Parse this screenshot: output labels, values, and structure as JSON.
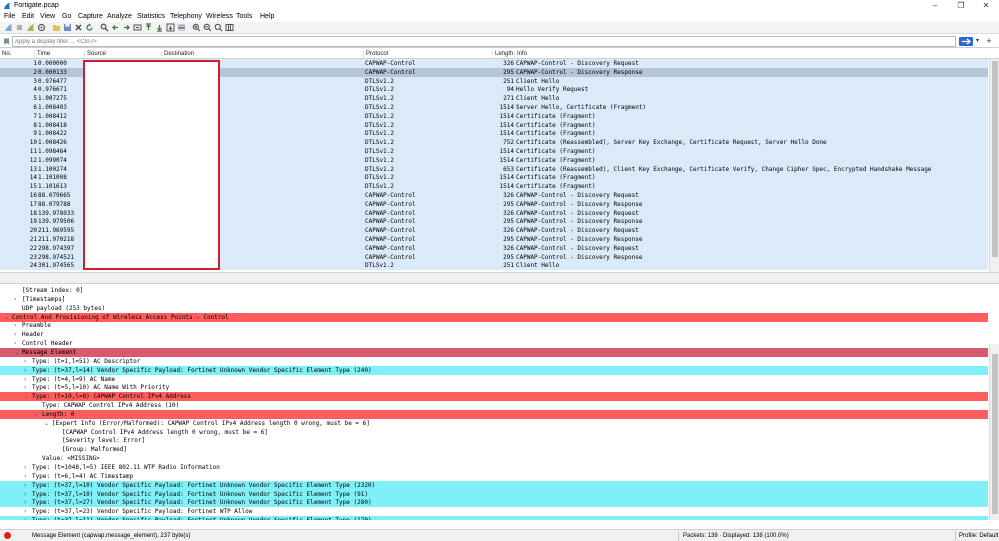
{
  "window": {
    "title": "Fortigate.pcap"
  },
  "menu": [
    "File",
    "Edit",
    "View",
    "Go",
    "Capture",
    "Analyze",
    "Statistics",
    "Telephony",
    "Wireless",
    "Tools",
    "Help"
  ],
  "filter": {
    "placeholder": "Apply a display filter ... <Ctrl-/>"
  },
  "columns": {
    "no": "No.",
    "time": "Time",
    "source": "Source",
    "destination": "Destination",
    "protocol": "Protocol",
    "length": "Length",
    "info": "Info"
  },
  "packets": [
    {
      "no": "1",
      "time": "0.000000",
      "protocol": "CAPWAP-Control",
      "length": "326",
      "info": "CAPWAP-Control - Discovery Request"
    },
    {
      "no": "2",
      "time": "0.000133",
      "protocol": "CAPWAP-Control",
      "length": "295",
      "info": "CAPWAP-Control - Discovery Response"
    },
    {
      "no": "3",
      "time": "0.976477",
      "protocol": "DTLSv1.2",
      "length": "251",
      "info": "Client Hello"
    },
    {
      "no": "4",
      "time": "0.976671",
      "protocol": "DTLSv1.2",
      "length": "94",
      "info": "Hello Verify Request"
    },
    {
      "no": "5",
      "time": "1.007275",
      "protocol": "DTLSv1.2",
      "length": "271",
      "info": "Client Hello"
    },
    {
      "no": "6",
      "time": "1.008403",
      "protocol": "DTLSv1.2",
      "length": "1514",
      "info": "Server Hello, Certificate (Fragment)"
    },
    {
      "no": "7",
      "time": "1.008412",
      "protocol": "DTLSv1.2",
      "length": "1514",
      "info": "Certificate (Fragment)"
    },
    {
      "no": "8",
      "time": "1.008418",
      "protocol": "DTLSv1.2",
      "length": "1514",
      "info": "Certificate (Fragment)"
    },
    {
      "no": "9",
      "time": "1.008422",
      "protocol": "DTLSv1.2",
      "length": "1514",
      "info": "Certificate (Fragment)"
    },
    {
      "no": "10",
      "time": "1.008426",
      "protocol": "DTLSv1.2",
      "length": "752",
      "info": "Certificate (Reassembled), Server Key Exchange, Certificate Request, Server Hello Done"
    },
    {
      "no": "11",
      "time": "1.098464",
      "protocol": "DTLSv1.2",
      "length": "1514",
      "info": "Certificate (Fragment)"
    },
    {
      "no": "12",
      "time": "1.099074",
      "protocol": "DTLSv1.2",
      "length": "1514",
      "info": "Certificate (Fragment)"
    },
    {
      "no": "13",
      "time": "1.100274",
      "protocol": "DTLSv1.2",
      "length": "653",
      "info": "Certificate (Reassembled), Client Key Exchange, Certificate Verify, Change Cipher Spec, Encrypted Handshake Message"
    },
    {
      "no": "14",
      "time": "1.101008",
      "protocol": "DTLSv1.2",
      "length": "1514",
      "info": "Certificate (Fragment)"
    },
    {
      "no": "15",
      "time": "1.101613",
      "protocol": "DTLSv1.2",
      "length": "1514",
      "info": "Certificate (Fragment)"
    },
    {
      "no": "16",
      "time": "88.079665",
      "protocol": "CAPWAP-Control",
      "length": "326",
      "info": "CAPWAP-Control - Discovery Request"
    },
    {
      "no": "17",
      "time": "88.079788",
      "protocol": "CAPWAP-Control",
      "length": "295",
      "info": "CAPWAP-Control - Discovery Response"
    },
    {
      "no": "18",
      "time": "139.978033",
      "protocol": "CAPWAP-Control",
      "length": "326",
      "info": "CAPWAP-Control - Discovery Request"
    },
    {
      "no": "19",
      "time": "139.979506",
      "protocol": "CAPWAP-Control",
      "length": "295",
      "info": "CAPWAP-Control - Discovery Response"
    },
    {
      "no": "20",
      "time": "211.969595",
      "protocol": "CAPWAP-Control",
      "length": "326",
      "info": "CAPWAP-Control - Discovery Request"
    },
    {
      "no": "21",
      "time": "211.970218",
      "protocol": "CAPWAP-Control",
      "length": "295",
      "info": "CAPWAP-Control - Discovery Response"
    },
    {
      "no": "22",
      "time": "298.974397",
      "protocol": "CAPWAP-Control",
      "length": "326",
      "info": "CAPWAP-Control - Discovery Request"
    },
    {
      "no": "23",
      "time": "298.974521",
      "protocol": "CAPWAP-Control",
      "length": "295",
      "info": "CAPWAP-Control - Discovery Response"
    },
    {
      "no": "24",
      "time": "301.974565",
      "protocol": "DTLSv1.2",
      "length": "251",
      "info": "Client Hello"
    }
  ],
  "details": [
    {
      "indent": 0,
      "arrow": "",
      "text": "[Stream index: 0]",
      "hl": ""
    },
    {
      "indent": 0,
      "arrow": ">",
      "text": "[Timestamps]",
      "hl": ""
    },
    {
      "indent": 0,
      "arrow": "",
      "text": "UDP payload (253 bytes)",
      "hl": ""
    },
    {
      "indent": -1,
      "arrow": "v",
      "text": "Control And Provisioning of Wireless Access Points - Control",
      "hl": "red"
    },
    {
      "indent": 0,
      "arrow": ">",
      "text": "Preamble",
      "hl": ""
    },
    {
      "indent": 0,
      "arrow": ">",
      "text": "Header",
      "hl": ""
    },
    {
      "indent": 0,
      "arrow": ">",
      "text": "Control Header",
      "hl": ""
    },
    {
      "indent": 0,
      "arrow": "v",
      "text": "Message Element",
      "hl": "pink"
    },
    {
      "indent": 1,
      "arrow": ">",
      "text": "Type: (t=1,l=51) AC Descriptor",
      "hl": ""
    },
    {
      "indent": 1,
      "arrow": ">",
      "text": "Type: (t=37,l=14) Vendor Specific Payload: Fortinet Unknown Vendor Specific Element Type (240)",
      "hl": "cyan"
    },
    {
      "indent": 1,
      "arrow": ">",
      "text": "Type: (t=4,l=9) AC Name",
      "hl": ""
    },
    {
      "indent": 1,
      "arrow": ">",
      "text": "Type: (t=5,l=10) AC Name With Priority",
      "hl": ""
    },
    {
      "indent": 1,
      "arrow": "v",
      "text": "Type: (t=10,l=0) CAPWAP Control IPv4 Address",
      "hl": "red"
    },
    {
      "indent": 2,
      "arrow": "",
      "text": "Type: CAPWAP Control IPv4 Address (10)",
      "hl": ""
    },
    {
      "indent": 2,
      "arrow": "v",
      "text": "Length: 0",
      "hl": "red"
    },
    {
      "indent": 3,
      "arrow": "v",
      "text": "[Expert Info (Error/Malformed): CAPWAP Control IPv4 Address length 0 wrong, must be = 6]",
      "hl": ""
    },
    {
      "indent": 4,
      "arrow": "",
      "text": "[CAPWAP Control IPv4 Address length 0 wrong, must be = 6]",
      "hl": ""
    },
    {
      "indent": 4,
      "arrow": "",
      "text": "[Severity level: Error]",
      "hl": ""
    },
    {
      "indent": 4,
      "arrow": "",
      "text": "[Group: Malformed]",
      "hl": ""
    },
    {
      "indent": 2,
      "arrow": "",
      "text": "Value: <MISSING>",
      "hl": ""
    },
    {
      "indent": 1,
      "arrow": ">",
      "text": "Type: (t=1048,l=5) IEEE 802.11 WTP Radio Information",
      "hl": ""
    },
    {
      "indent": 1,
      "arrow": ">",
      "text": "Type: (t=6,l=4) AC Timestamp",
      "hl": ""
    },
    {
      "indent": 1,
      "arrow": ">",
      "text": "Type: (t=37,l=10) Vendor Specific Payload: Fortinet Unknown Vendor Specific Element Type (2320)",
      "hl": "cyan"
    },
    {
      "indent": 1,
      "arrow": ">",
      "text": "Type: (t=37,l=10) Vendor Specific Payload: Fortinet Unknown Vendor Specific Element Type (91)",
      "hl": "cyan"
    },
    {
      "indent": 1,
      "arrow": ">",
      "text": "Type: (t=37,l=27) Vendor Specific Payload: Fortinet Unknown Vendor Specific Element Type (280)",
      "hl": "cyan"
    },
    {
      "indent": 1,
      "arrow": ">",
      "text": "Type: (t=37,l=23) Vendor Specific Payload: Fortinet WTP Allow",
      "hl": ""
    },
    {
      "indent": 1,
      "arrow": ">",
      "text": "Type: (t=37,l=11) Vendor Specific Payload: Fortinet Unknown Vendor Specific Element Type (170)",
      "hl": "cyan"
    }
  ],
  "status": {
    "message": "Message Element (capwap.message_element), 237 byte(s)",
    "packets": "Packets: 138 · Displayed: 138 (100.0%)",
    "profile": "Profile: Default"
  },
  "colors": {
    "row_bg": "#dbeaf9",
    "selected_row": "#b4c6d8",
    "error_red": "#ff5c5c",
    "element_pink": "#d75a6e",
    "vendor_cyan": "#7ff0f7",
    "redaction_border": "#cc1f2a"
  }
}
